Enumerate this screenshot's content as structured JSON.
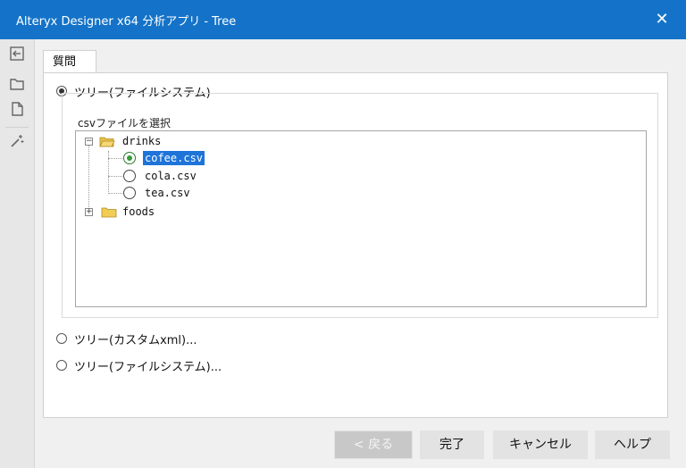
{
  "window": {
    "title": "Alteryx Designer x64 分析アプリ - Tree",
    "close_glyph": "✕"
  },
  "sidebar": {
    "icons": [
      "back-arrow-icon",
      "folder-icon",
      "document-icon",
      "magic-wand-icon"
    ]
  },
  "tab": {
    "label": "質問"
  },
  "options": [
    {
      "label": "ツリー(ファイルシステム)",
      "selected": true
    },
    {
      "label": "ツリー(カスタムxml)...",
      "selected": false
    },
    {
      "label": "ツリー(ファイルシステム)...",
      "selected": false
    }
  ],
  "group": {
    "label": "csvファイルを選択"
  },
  "tree": {
    "nodes": [
      {
        "label": "drinks",
        "expanded": true,
        "children": [
          {
            "label": "cofee.csv",
            "selected": true
          },
          {
            "label": "cola.csv",
            "selected": false
          },
          {
            "label": "tea.csv",
            "selected": false
          }
        ]
      },
      {
        "label": "foods",
        "expanded": false,
        "children": []
      }
    ],
    "expand_glyph": "+",
    "collapse_glyph": "−"
  },
  "footer": {
    "back_label": "< 戻る",
    "finish_label": "完了",
    "cancel_label": "キャンセル",
    "help_label": "ヘルプ"
  },
  "colors": {
    "titlebar": "#1473c8",
    "selection": "#1e74d8"
  }
}
